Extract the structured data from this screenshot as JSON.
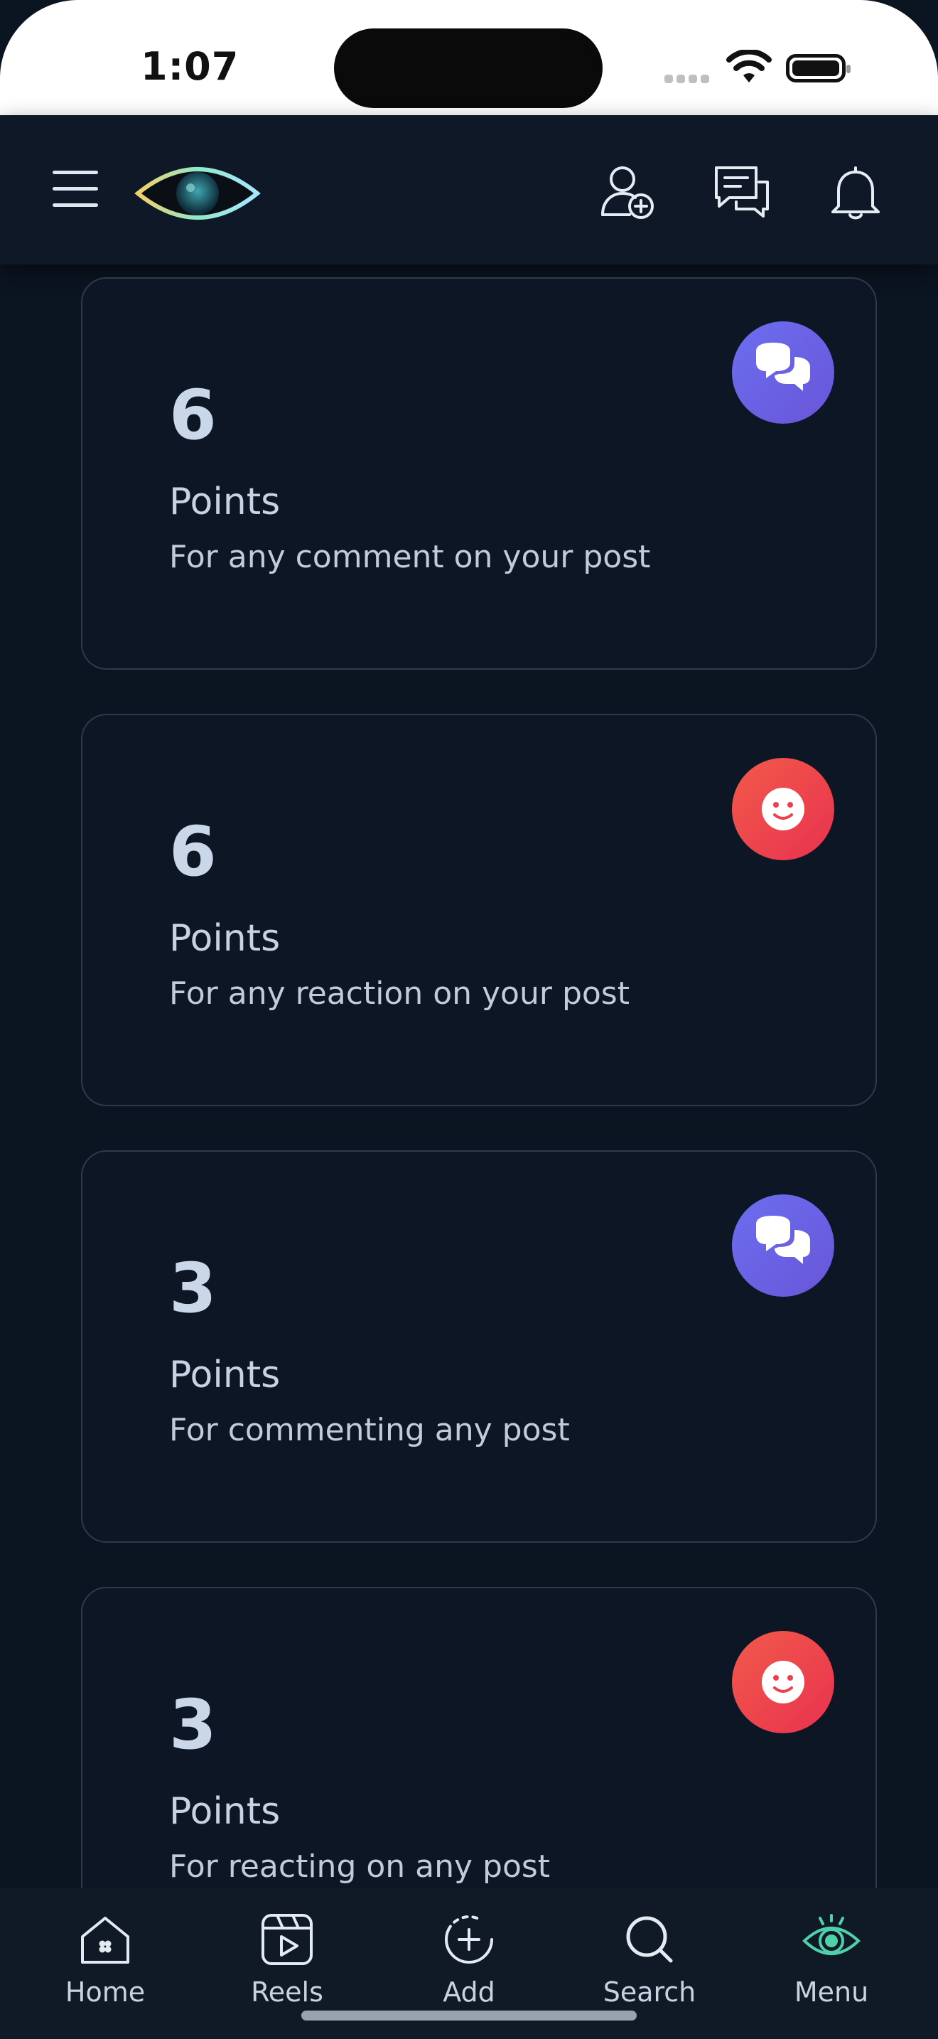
{
  "status_bar": {
    "time": "1:07"
  },
  "header": {
    "icons": [
      "menu-icon",
      "eye-logo",
      "add-friend-icon",
      "messages-icon",
      "bell-icon"
    ]
  },
  "cards": [
    {
      "points": "6",
      "unit": "Points",
      "description": "For any comment on your post",
      "icon": "comments-icon",
      "color": "#6b6ef0"
    },
    {
      "points": "6",
      "unit": "Points",
      "description": "For any reaction on your post",
      "icon": "smile-icon",
      "color": "#f04a4c"
    },
    {
      "points": "3",
      "unit": "Points",
      "description": "For commenting any post",
      "icon": "comments-icon",
      "color": "#6b6ef0"
    },
    {
      "points": "3",
      "unit": "Points",
      "description": "For reacting on any post",
      "icon": "smile-icon",
      "color": "#f04a4c"
    }
  ],
  "bottom_nav": {
    "items": [
      {
        "label": "Home",
        "icon": "home-icon"
      },
      {
        "label": "Reels",
        "icon": "reels-icon"
      },
      {
        "label": "Add",
        "icon": "add-icon"
      },
      {
        "label": "Search",
        "icon": "search-icon"
      },
      {
        "label": "Menu",
        "icon": "eye-menu-icon"
      }
    ]
  }
}
